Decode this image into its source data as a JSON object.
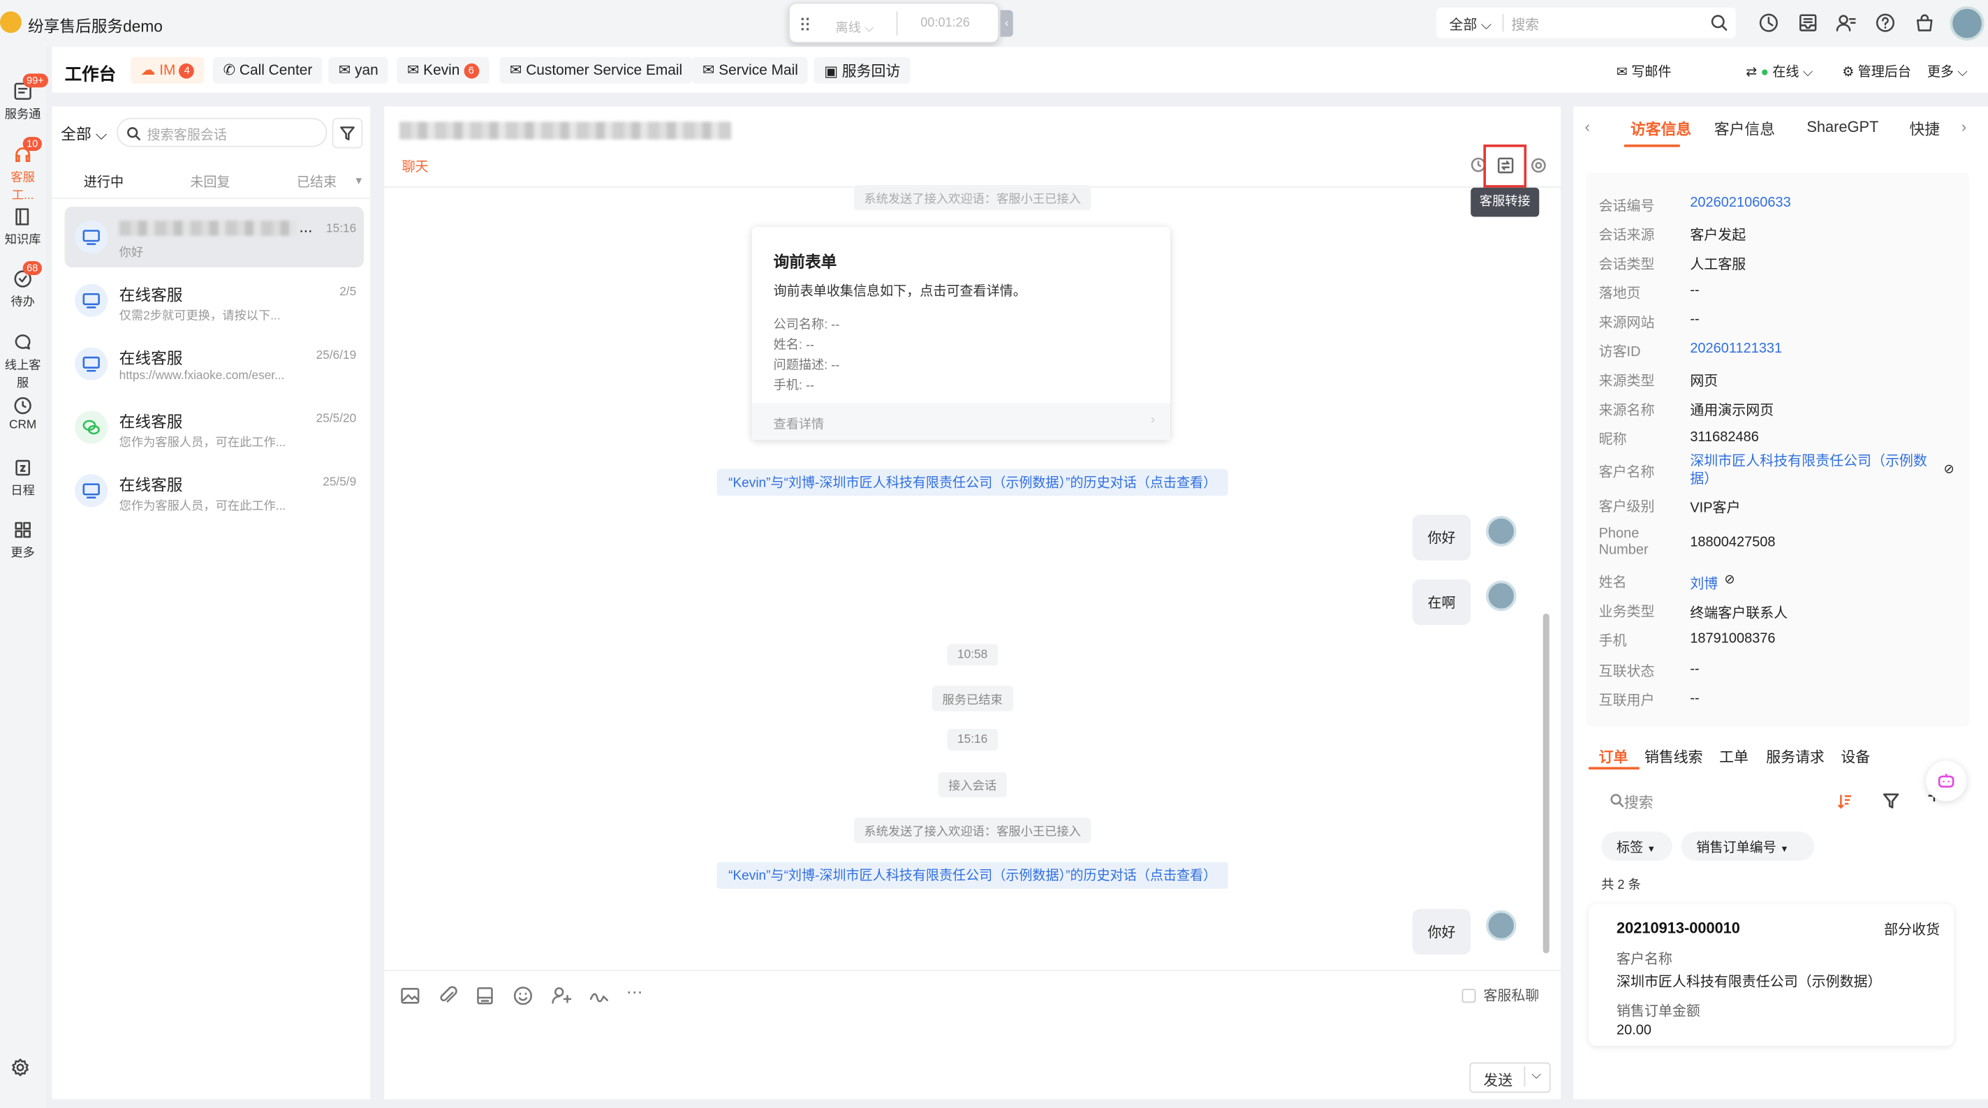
{
  "app": {
    "title": "纷享售后服务demo"
  },
  "callbar": {
    "status": "离线",
    "timer": "00:01:26"
  },
  "global_search": {
    "scope": "全部",
    "placeholder": "搜索"
  },
  "rail": {
    "items": [
      {
        "label": "服务通",
        "badge": "99+"
      },
      {
        "label": "客服工...",
        "badge": "10"
      },
      {
        "label": "知识库",
        "badge": ""
      },
      {
        "label": "待办",
        "badge": "68"
      },
      {
        "label": "线上客服",
        "badge": ""
      },
      {
        "label": "CRM",
        "badge": ""
      },
      {
        "label": "日程",
        "badge": ""
      },
      {
        "label": "更多",
        "badge": ""
      }
    ]
  },
  "tabbar": {
    "title": "工作台",
    "channels": [
      {
        "label": "IM",
        "badge": "4"
      },
      {
        "label": "Call Center",
        "badge": ""
      },
      {
        "label": "yan",
        "badge": ""
      },
      {
        "label": "Kevin",
        "badge": "6"
      },
      {
        "label": "Customer Service Email",
        "badge": ""
      },
      {
        "label": "Service Mail",
        "badge": ""
      },
      {
        "label": "服务回访",
        "badge": ""
      }
    ],
    "right_tools": {
      "write_mail": "写邮件",
      "online": "在线",
      "admin": "管理后台",
      "more": "更多"
    }
  },
  "convlist": {
    "filter": "全部",
    "search_placeholder": "搜索客服会话",
    "tabs": [
      "进行中",
      "未回复",
      "已结束"
    ],
    "items": [
      {
        "name": "...",
        "preview": "你好",
        "time": "15:16"
      },
      {
        "name": "在线客服",
        "preview": "仅需2步就可更换，请按以下...",
        "time": "2/5"
      },
      {
        "name": "在线客服",
        "preview": "https://www.fxiaoke.com/eser...",
        "time": "25/6/19"
      },
      {
        "name": "在线客服",
        "preview": "您作为客服人员，可在此工作...",
        "time": "25/5/20"
      },
      {
        "name": "在线客服",
        "preview": "您作为客服人员，可在此工作...",
        "time": "25/5/9"
      }
    ]
  },
  "chat": {
    "tab": "聊天",
    "tooltip": "客服转接",
    "top_system": "系统发送了接入欢迎语：客服小王已接入",
    "form": {
      "title": "询前表单",
      "desc": "询前表单收集信息如下，点击可查看详情。",
      "fields": [
        "公司名称:  --",
        "姓名:  --",
        "问题描述:  --",
        "手机:  --"
      ],
      "footer": "查看详情"
    },
    "history_link": "“Kevin”与“刘博-深圳市匠人科技有限责任公司（示例数据）”的历史对话（点击查看）",
    "messages": [
      "你好",
      "在啊",
      "你好"
    ],
    "time1": "10:58",
    "ended": "服务已结束",
    "time2": "15:16",
    "joined": "接入会话",
    "welcome": "系统发送了接入欢迎语：客服小王已接入",
    "private_chat": "客服私聊",
    "send": "发送"
  },
  "rpanel": {
    "tabs": [
      "访客信息",
      "客户信息",
      "ShareGPT",
      "快捷"
    ],
    "info": [
      {
        "label": "会话编号",
        "value": "2026021060633",
        "link": true
      },
      {
        "label": "会话来源",
        "value": "客户发起"
      },
      {
        "label": "会话类型",
        "value": "人工客服"
      },
      {
        "label": "落地页",
        "value": "--"
      },
      {
        "label": "来源网站",
        "value": "--"
      },
      {
        "label": "访客ID",
        "value": "202601121331",
        "link": true
      },
      {
        "label": "来源类型",
        "value": "网页"
      },
      {
        "label": "来源名称",
        "value": "通用演示网页"
      },
      {
        "label": "昵称",
        "value": "311682486"
      },
      {
        "label": "客户名称",
        "value": "深圳市匠人科技有限责任公司（示例数据）",
        "link": true
      },
      {
        "label": "客户级别",
        "value": "VIP客户"
      },
      {
        "label": "Phone Number",
        "value": "18800427508"
      },
      {
        "label": "姓名",
        "value": "刘博",
        "link": true
      },
      {
        "label": "业务类型",
        "value": "终端客户联系人"
      },
      {
        "label": "手机",
        "value": "18791008376"
      },
      {
        "label": "互联状态",
        "value": "--"
      },
      {
        "label": "互联用户",
        "value": "--"
      }
    ],
    "subtabs": [
      "订单",
      "销售线索",
      "工单",
      "服务请求",
      "设备"
    ],
    "search_placeholder": "搜索",
    "chips": [
      "标签",
      "销售订单编号"
    ],
    "count": "共 2 条",
    "order": {
      "id": "20210913-000010",
      "status": "部分收货",
      "customer_label": "客户名称",
      "customer": "深圳市匠人科技有限责任公司（示例数据）",
      "amount_label": "销售订单金额",
      "amount": "20.00"
    }
  },
  "colors": {
    "accent": "#f4662f",
    "link": "#2f6fe0",
    "badge": "#f45a3a",
    "online": "#2fbf5a",
    "highlight_box": "#e53935"
  }
}
